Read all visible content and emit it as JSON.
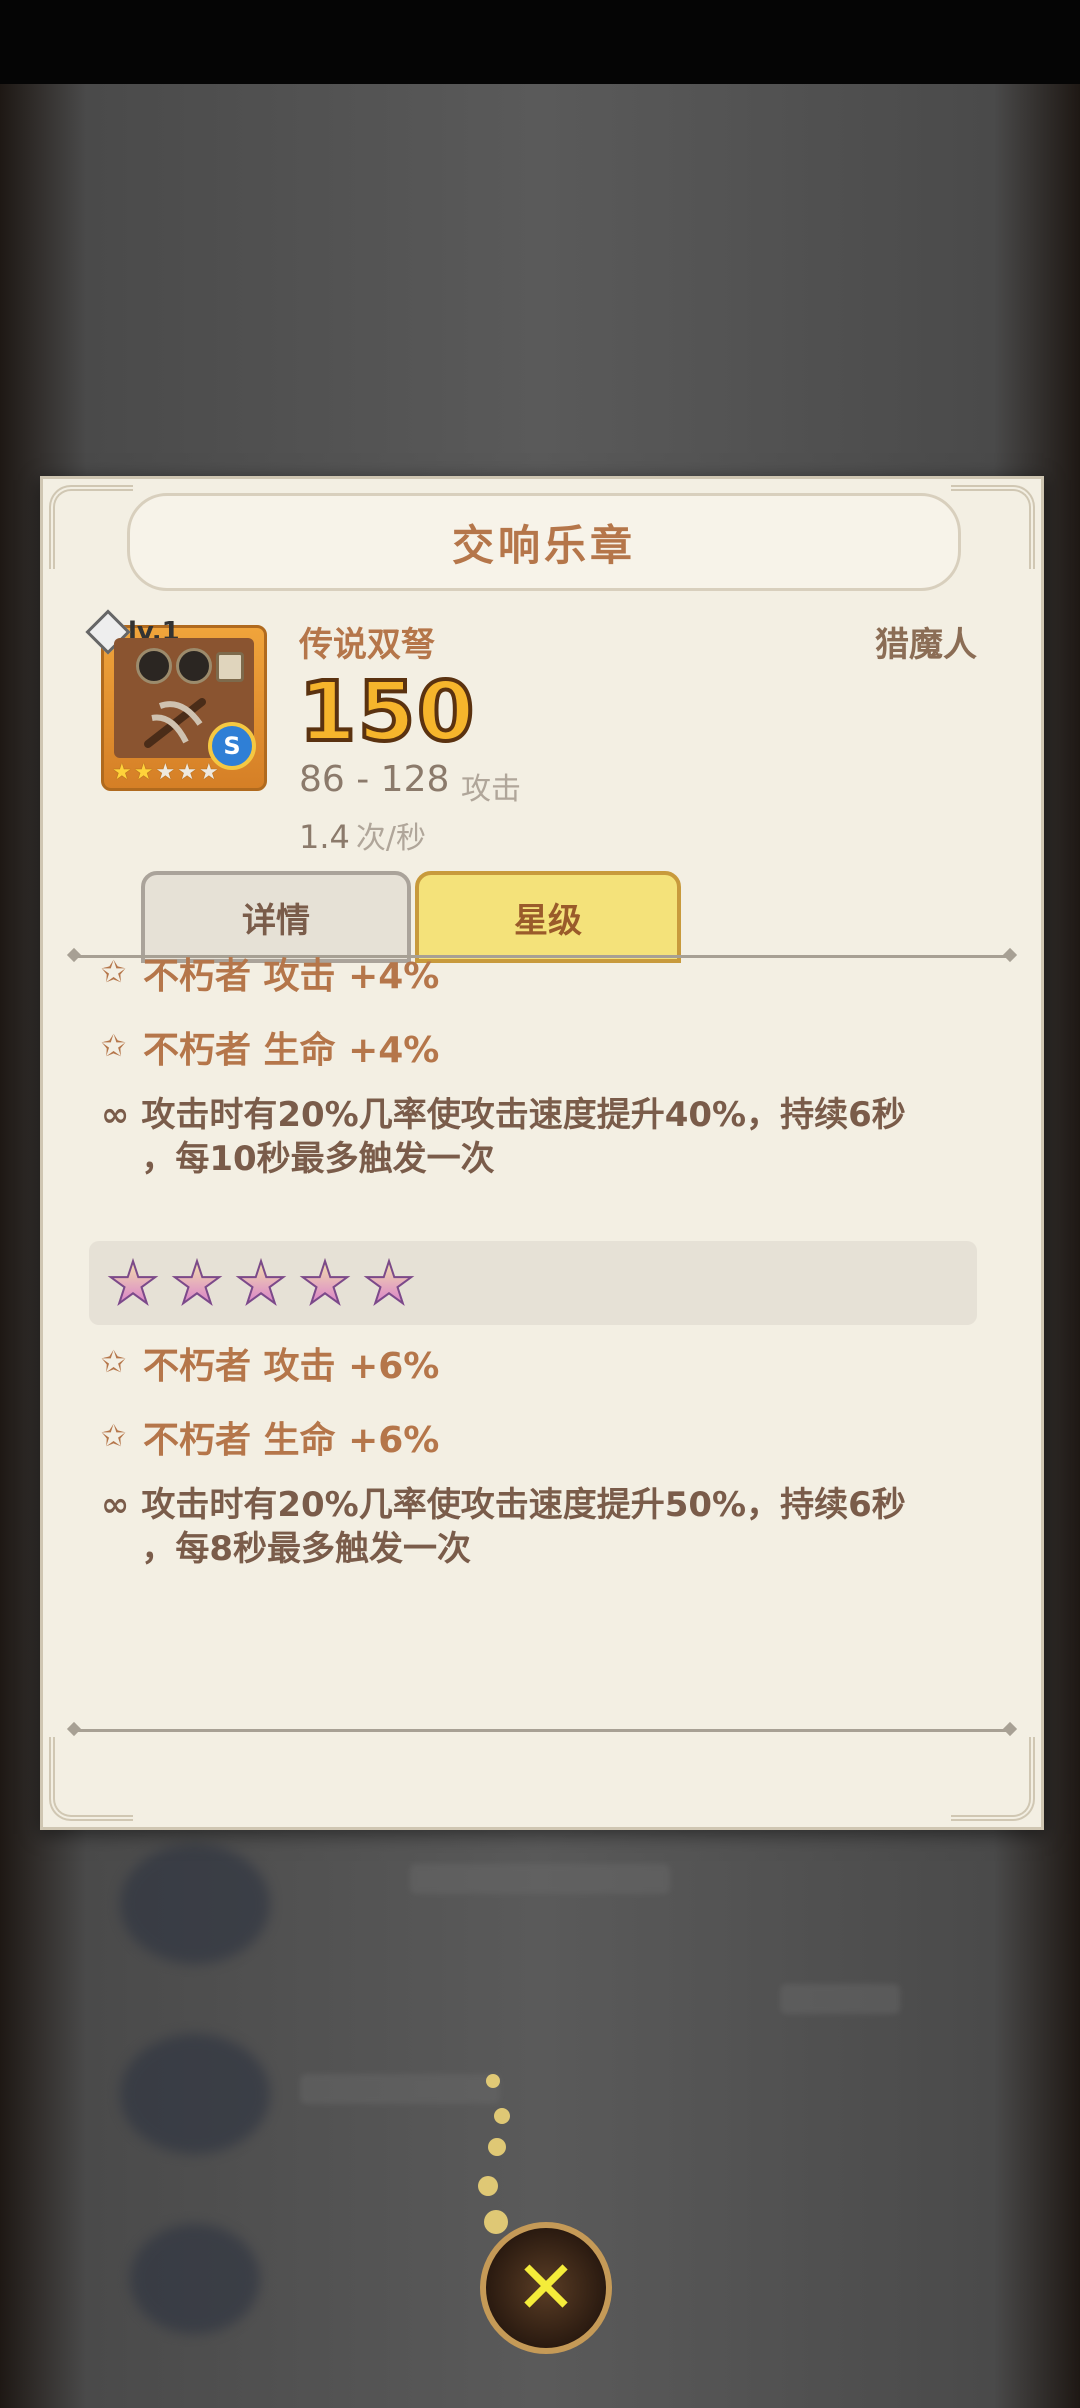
{
  "dialog": {
    "title": "交响乐章",
    "item": {
      "level": "lv.1",
      "name": "传说双弩",
      "class": "猎魔人",
      "power": "150",
      "attack_range": "86 - 128",
      "attack_label": "攻击",
      "speed_value": "1.4",
      "speed_unit": "次/秒",
      "rarity_stars_filled": 2,
      "rarity_stars_total": 5,
      "coin_symbol": "S"
    },
    "tabs": [
      {
        "label": "详情",
        "active": false
      },
      {
        "label": "星级",
        "active": true
      }
    ],
    "tier4": {
      "stats": [
        "不朽者 攻击 +4%",
        "不朽者 生命 +4%"
      ],
      "skill_line1": "攻击时有20%几率使攻击速度提升40%，持续6秒",
      "skill_line2": "，每10秒最多触发一次"
    },
    "tier5": {
      "star_count": 5,
      "stats": [
        "不朽者 攻击 +6%",
        "不朽者 生命 +6%"
      ],
      "skill_line1": "攻击时有20%几率使攻击速度提升50%，持续6秒",
      "skill_line2": "，每8秒最多触发一次"
    }
  },
  "close_button": {
    "icon": "close-x-icon"
  },
  "colors": {
    "accent": "#b5764a",
    "tab_active": "#f4e27a",
    "power_gold": "#f6b52c"
  }
}
